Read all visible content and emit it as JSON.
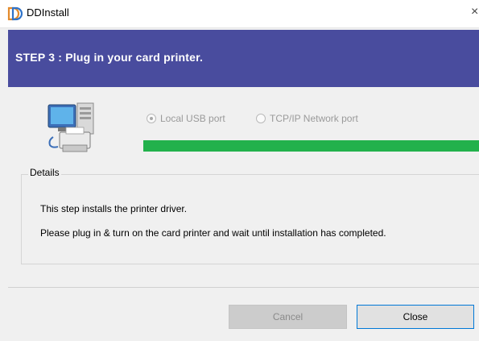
{
  "window": {
    "title": "DDInstall",
    "close_glyph": "×"
  },
  "header": {
    "step_text": "STEP 3 :  Plug in your card printer.",
    "bg_color": "#494c9e"
  },
  "illustration": {
    "icon": "computer-printer-icon"
  },
  "ports": [
    {
      "label": "Local USB port",
      "selected": true,
      "enabled": false
    },
    {
      "label": "TCP/IP Network port",
      "selected": false,
      "enabled": false
    }
  ],
  "progress": {
    "value": 1.0,
    "color": "#22b14c"
  },
  "details": {
    "legend": "Details",
    "line1": "This step installs the printer driver.",
    "line2": "Please plug in & turn on the card printer and wait until installation has completed."
  },
  "buttons": {
    "cancel": "Cancel",
    "close": "Close"
  }
}
